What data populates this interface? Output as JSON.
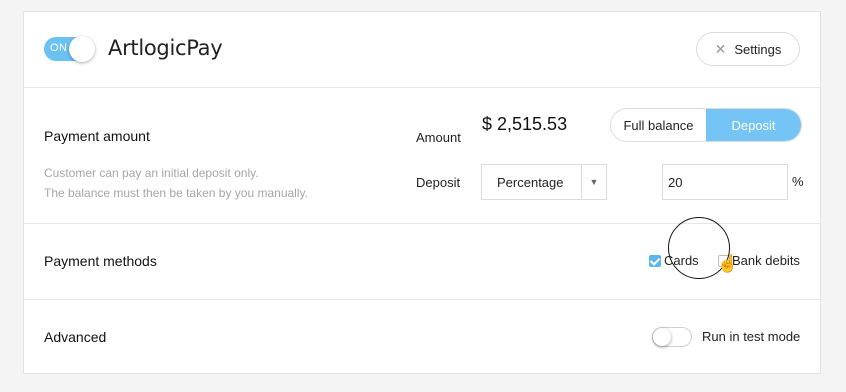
{
  "header": {
    "toggle_label": "ON",
    "logo_text": "ArtlogicPay",
    "settings_label": "Settings",
    "settings_icon": "close-icon"
  },
  "payment_amount": {
    "title": "Payment amount",
    "amount_label": "Amount",
    "amount_value": "$ 2,515.53",
    "options": [
      "Full balance",
      "Deposit"
    ],
    "selected_option": "Deposit",
    "description_line1": "Customer can pay an initial deposit only.",
    "description_line2": "The balance must then be taken by you manually.",
    "deposit_label": "Deposit",
    "deposit_type": "Percentage",
    "deposit_value": "20",
    "percent_sign": "%"
  },
  "payment_methods": {
    "title": "Payment methods",
    "cards_label": "Cards",
    "cards_checked": true,
    "bank_label": "Bank debits",
    "bank_checked": false
  },
  "advanced": {
    "title": "Advanced",
    "test_mode_label": "Run in test mode",
    "test_mode_on": false
  },
  "colors": {
    "accent": "#6cc1f3",
    "muted_text": "#a6a6a6",
    "border": "#dcdcdc"
  }
}
